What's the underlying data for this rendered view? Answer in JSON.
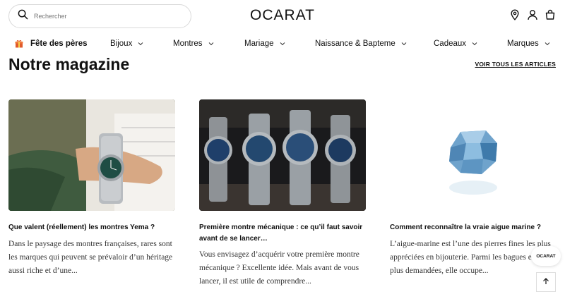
{
  "header": {
    "search_placeholder": "Rechercher",
    "logo": "OCARAT",
    "icons": [
      "location-icon",
      "user-icon",
      "cart-icon"
    ]
  },
  "nav": {
    "items": [
      {
        "label": "Fête des pères",
        "icon": "gift-icon",
        "has_dropdown": false
      },
      {
        "label": "Bijoux",
        "has_dropdown": true
      },
      {
        "label": "Montres",
        "has_dropdown": true
      },
      {
        "label": "Mariage",
        "has_dropdown": true
      },
      {
        "label": "Naissance & Bapteme",
        "has_dropdown": true
      },
      {
        "label": "Cadeaux",
        "has_dropdown": true
      },
      {
        "label": "Marques",
        "has_dropdown": true
      }
    ]
  },
  "section": {
    "title": "Notre magazine",
    "see_all": "VOIR TOUS LES ARTICLES"
  },
  "articles": [
    {
      "title": "Que valent (réellement) les montres Yema ?",
      "excerpt": "Dans le paysage des montres françaises, rares sont les marques qui peuvent se prévaloir d’un héritage aussi riche et d’une..."
    },
    {
      "title": "Première montre mécanique : ce qu’il faut savoir avant de se lancer…",
      "excerpt": "Vous envisagez d’acquérir votre première montre mécanique ? Excellente idée. Mais avant de vous lancer, il est utile de comprendre..."
    },
    {
      "title": "Comment reconnaître la vraie aigue marine ?",
      "excerpt": "L’aigue-marine est l’une des pierres fines les plus appréciées en bijouterie. Parmi les bagues en or les plus demandées, elle occupe..."
    }
  ],
  "floating": {
    "badge": "OCARAT",
    "scroll_top_icon": "arrow-up-icon"
  }
}
